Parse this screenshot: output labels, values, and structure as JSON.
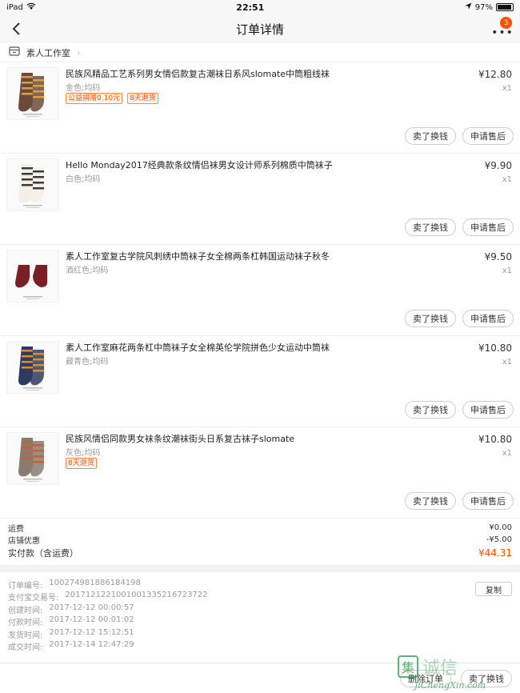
{
  "status": {
    "device": "iPad",
    "time": "22:51",
    "battery": "97%",
    "battery_level": 0.97
  },
  "nav": {
    "title": "订单详情",
    "badge": "3"
  },
  "shop": {
    "name": "素人工作室"
  },
  "items": [
    {
      "title": "民族风精品工艺系列男女情侣款复古潮袜日系风slomate中筒粗线袜",
      "variant": "金色;均码",
      "tags": [
        "公益捐赠0.10元",
        "8天退货"
      ],
      "price": "¥12.80",
      "qty": "x1",
      "sock_color": "#6b4a3a",
      "stripe_color": "#d9a040",
      "actions": [
        "卖了换钱",
        "申请售后"
      ]
    },
    {
      "title": "Hello Monday2017经典款条纹情侣袜男女设计师系列棉质中筒袜子",
      "variant": "白色;均码",
      "tags": [],
      "price": "¥9.90",
      "qty": "x1",
      "sock_color": "#f3efe6",
      "stripe_color": "#3a3a3a",
      "actions": [
        "卖了换钱",
        "申请售后"
      ]
    },
    {
      "title": "素人工作室复古学院风刺绣中筒袜子女全棉两条杠韩国运动袜子秋冬",
      "variant": "酒红色;均码",
      "tags": [],
      "price": "¥9.50",
      "qty": "x1",
      "sock_color": "#7a1f26",
      "stripe_color": "#7a1f26",
      "actions": [
        "卖了换钱",
        "申请售后"
      ]
    },
    {
      "title": "素人工作室麻花两条杠中筒袜子女全棉英伦学院拼色少女运动中筒袜",
      "variant": "藏青色;均码",
      "tags": [],
      "price": "¥10.80",
      "qty": "x1",
      "sock_color": "#2d3b63",
      "stripe_color": "#e28a2b",
      "actions": [
        "卖了换钱",
        "申请售后"
      ]
    },
    {
      "title": "民族风情侣同款男女袜条纹潮袜街头日系复古袜子slomate",
      "variant": "灰色;均码",
      "tags": [
        "8天退货"
      ],
      "price": "¥10.80",
      "qty": "x1",
      "sock_color": "#8a7b70",
      "stripe_color": "#c0623a",
      "actions": [
        "卖了换钱",
        "申请售后"
      ]
    }
  ],
  "summary": {
    "shipping_label": "运费",
    "shipping_value": "¥0.00",
    "discount_label": "店铺优惠",
    "discount_value": "-¥5.00",
    "total_label": "实付款（含运费）",
    "total_value": "¥44.31"
  },
  "info": {
    "copy_label": "复制",
    "rows": [
      {
        "label": "订单编号:",
        "value": "100274981886184198"
      },
      {
        "label": "支付宝交易号:",
        "value": "2017121221001001335216723722"
      },
      {
        "label": "创建时间:",
        "value": "2017-12-12 00:00:57"
      },
      {
        "label": "付款时间:",
        "value": "2017-12-12 00:01:02"
      },
      {
        "label": "发货时间:",
        "value": "2017-12-12 15:12:51"
      },
      {
        "label": "成交时间:",
        "value": "2017-12-14 12:47:29"
      }
    ]
  },
  "bottom": {
    "delete_label": "删除订单",
    "sell_label": "卖了换钱"
  },
  "watermark": {
    "brand": "集诚信",
    "url": "JiChengXin.com"
  },
  "colors": {
    "accent": "#ff5000"
  }
}
